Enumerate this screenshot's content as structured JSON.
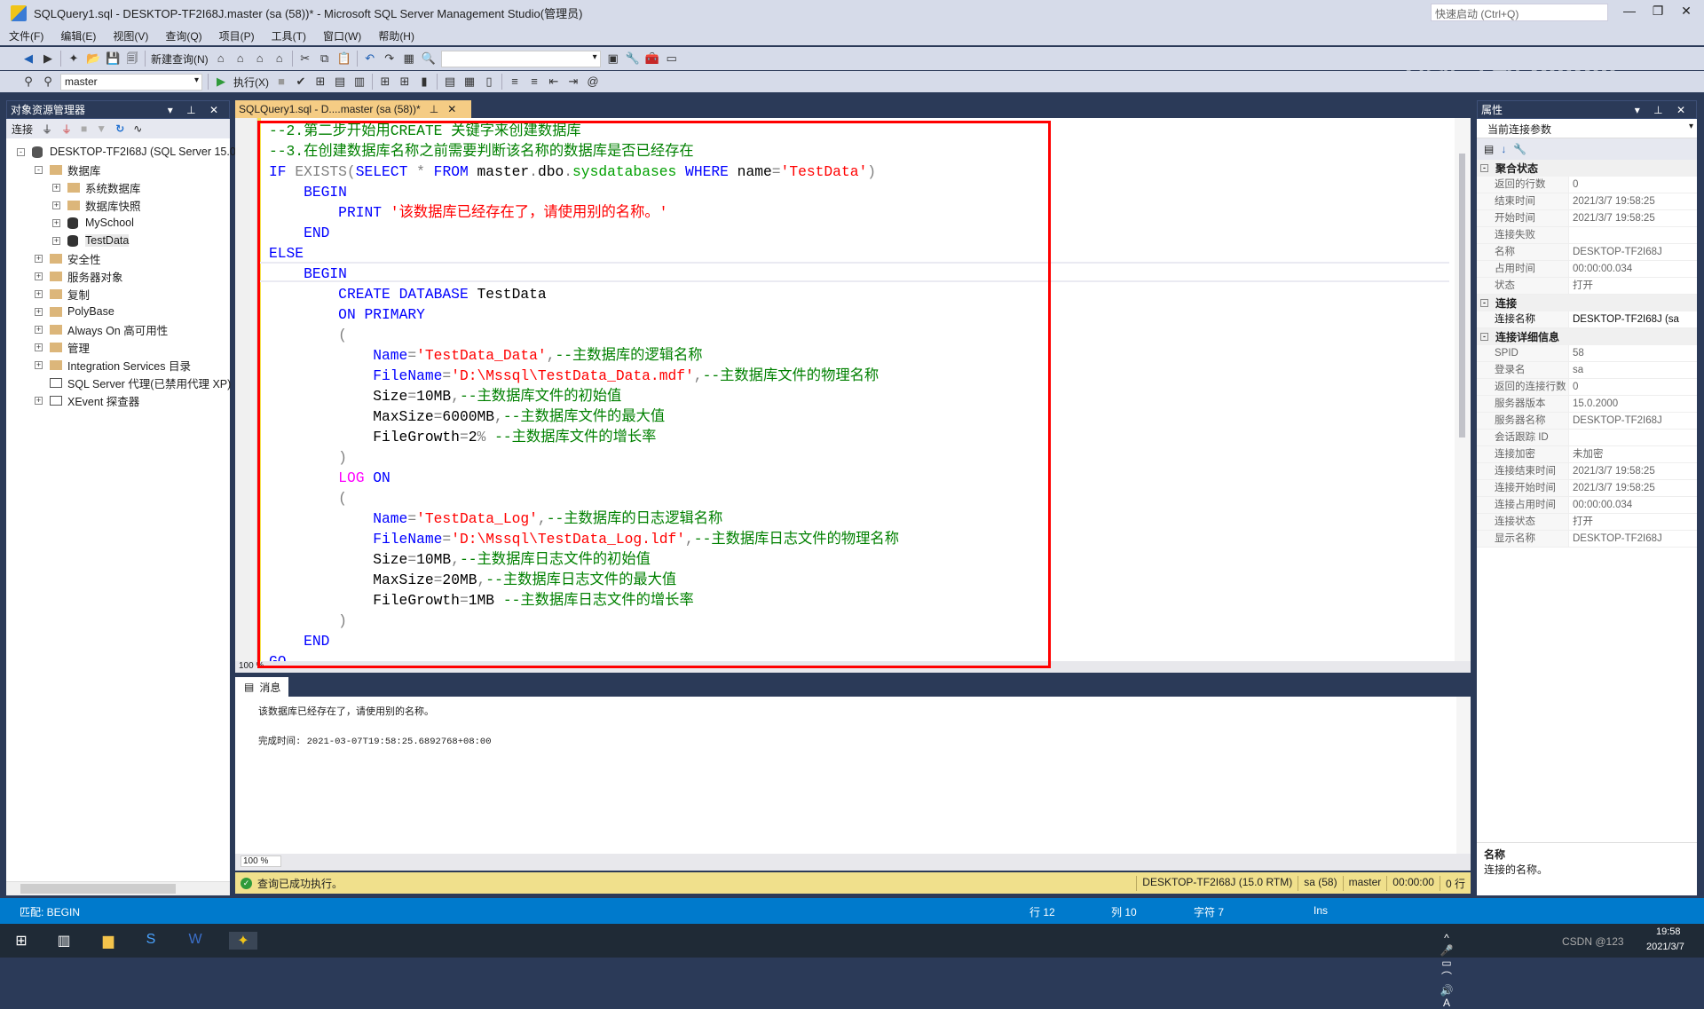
{
  "window": {
    "title": "SQLQuery1.sql - DESKTOP-TF2I68J.master (sa (58))* - Microsoft SQL Server Management Studio(管理员)",
    "quick_launch": "快速启动 (Ctrl+Q)"
  },
  "menu": [
    "文件(F)",
    "编辑(E)",
    "视图(V)",
    "查询(Q)",
    "项目(P)",
    "工具(T)",
    "窗口(W)",
    "帮助(H)"
  ],
  "toolbar": {
    "new_query": "新建查询(N)",
    "execute": "执行(X)",
    "database": "master"
  },
  "watermark": "九维互动 bilibili",
  "object_explorer": {
    "title": "对象资源管理器",
    "connect": "连接",
    "items": [
      {
        "label": "DESKTOP-TF2I68J (SQL Server 15.0",
        "level": 0,
        "state": "-",
        "icon": "server"
      },
      {
        "label": "数据库",
        "level": 1,
        "state": "-",
        "icon": "folder"
      },
      {
        "label": "系统数据库",
        "level": 2,
        "state": "+",
        "icon": "folder"
      },
      {
        "label": "数据库快照",
        "level": 2,
        "state": "+",
        "icon": "folder"
      },
      {
        "label": "MySchool",
        "level": 2,
        "state": "+",
        "icon": "database"
      },
      {
        "label": "TestData",
        "level": 2,
        "state": "+",
        "icon": "database"
      },
      {
        "label": "安全性",
        "level": 1,
        "state": "+",
        "icon": "folder"
      },
      {
        "label": "服务器对象",
        "level": 1,
        "state": "+",
        "icon": "folder"
      },
      {
        "label": "复制",
        "level": 1,
        "state": "+",
        "icon": "folder"
      },
      {
        "label": "PolyBase",
        "level": 1,
        "state": "+",
        "icon": "folder"
      },
      {
        "label": "Always On 高可用性",
        "level": 1,
        "state": "+",
        "icon": "folder"
      },
      {
        "label": "管理",
        "level": 1,
        "state": "+",
        "icon": "folder"
      },
      {
        "label": "Integration Services 目录",
        "level": 1,
        "state": "+",
        "icon": "folder"
      },
      {
        "label": "SQL Server 代理(已禁用代理 XP)",
        "level": 1,
        "state": "",
        "icon": "agent"
      },
      {
        "label": "XEvent 探查器",
        "level": 1,
        "state": "+",
        "icon": "xevent"
      }
    ]
  },
  "editor": {
    "tab": "SQLQuery1.sql - D....master (sa (58))*",
    "zoom": "100 %",
    "lines": [
      [
        [
          "c",
          "--2.第二步开始用CREATE 关键字来创建数据库"
        ]
      ],
      [
        [
          "c",
          "--3.在创建数据库名称之前需要判断该名称的数据库是否已经存在"
        ]
      ],
      [
        [
          "k",
          "IF "
        ],
        [
          "g",
          "EXISTS("
        ],
        [
          "k",
          "SELECT "
        ],
        [
          "g",
          "* "
        ],
        [
          "k",
          "FROM "
        ],
        [
          "p",
          "master"
        ],
        [
          "g",
          "."
        ],
        [
          "p",
          "dbo"
        ],
        [
          "g",
          "."
        ],
        [
          "f",
          "sysdatabases "
        ],
        [
          "k",
          "WHERE "
        ],
        [
          "p",
          "name"
        ],
        [
          "g",
          "="
        ],
        [
          "s",
          "'TestData'"
        ],
        [
          "g",
          ")"
        ]
      ],
      [
        [
          "p",
          "    "
        ],
        [
          "k",
          "BEGIN"
        ]
      ],
      [
        [
          "p",
          "        "
        ],
        [
          "k",
          "PRINT "
        ],
        [
          "s",
          "'该数据库已经存在了，请使用别的名称。'"
        ]
      ],
      [
        [
          "p",
          "    "
        ],
        [
          "k",
          "END"
        ]
      ],
      [
        [
          "k",
          "ELSE"
        ]
      ],
      [
        [
          "p",
          "    "
        ],
        [
          "k",
          "BEGIN"
        ]
      ],
      [
        [
          "p",
          "        "
        ],
        [
          "k",
          "CREATE DATABASE "
        ],
        [
          "p",
          "TestData"
        ]
      ],
      [
        [
          "p",
          "        "
        ],
        [
          "k",
          "ON PRIMARY"
        ]
      ],
      [
        [
          "p",
          "        "
        ],
        [
          "g",
          "("
        ]
      ],
      [
        [
          "p",
          "            "
        ],
        [
          "k",
          "Name"
        ],
        [
          "g",
          "="
        ],
        [
          "s",
          "'TestData_Data'"
        ],
        [
          "g",
          ","
        ],
        [
          "c",
          "--主数据库的逻辑名称"
        ]
      ],
      [
        [
          "p",
          "            "
        ],
        [
          "k",
          "FileName"
        ],
        [
          "g",
          "="
        ],
        [
          "s",
          "'D:\\Mssql\\TestData_Data.mdf'"
        ],
        [
          "g",
          ","
        ],
        [
          "c",
          "--主数据库文件的物理名称"
        ]
      ],
      [
        [
          "p",
          "            Size"
        ],
        [
          "g",
          "="
        ],
        [
          "p",
          "10MB"
        ],
        [
          "g",
          ","
        ],
        [
          "c",
          "--主数据库文件的初始值"
        ]
      ],
      [
        [
          "p",
          "            MaxSize"
        ],
        [
          "g",
          "="
        ],
        [
          "p",
          "6000MB"
        ],
        [
          "g",
          ","
        ],
        [
          "c",
          "--主数据库文件的最大值"
        ]
      ],
      [
        [
          "p",
          "            FileGrowth"
        ],
        [
          "g",
          "="
        ],
        [
          "p",
          "2"
        ],
        [
          "g",
          "% "
        ],
        [
          "c",
          "--主数据库文件的增长率"
        ]
      ],
      [
        [
          "p",
          "        "
        ],
        [
          "g",
          ")"
        ]
      ],
      [
        [
          "p",
          "        "
        ],
        [
          "m",
          "LOG "
        ],
        [
          "k",
          "ON"
        ]
      ],
      [
        [
          "p",
          "        "
        ],
        [
          "g",
          "("
        ]
      ],
      [
        [
          "p",
          "            "
        ],
        [
          "k",
          "Name"
        ],
        [
          "g",
          "="
        ],
        [
          "s",
          "'TestData_Log'"
        ],
        [
          "g",
          ","
        ],
        [
          "c",
          "--主数据库的日志逻辑名称"
        ]
      ],
      [
        [
          "p",
          "            "
        ],
        [
          "k",
          "FileName"
        ],
        [
          "g",
          "="
        ],
        [
          "s",
          "'D:\\Mssql\\TestData_Log.ldf'"
        ],
        [
          "g",
          ","
        ],
        [
          "c",
          "--主数据库日志文件的物理名称"
        ]
      ],
      [
        [
          "p",
          "            Size"
        ],
        [
          "g",
          "="
        ],
        [
          "p",
          "10MB"
        ],
        [
          "g",
          ","
        ],
        [
          "c",
          "--主数据库日志文件的初始值"
        ]
      ],
      [
        [
          "p",
          "            MaxSize"
        ],
        [
          "g",
          "="
        ],
        [
          "p",
          "20MB"
        ],
        [
          "g",
          ","
        ],
        [
          "c",
          "--主数据库日志文件的最大值"
        ]
      ],
      [
        [
          "p",
          "            FileGrowth"
        ],
        [
          "g",
          "="
        ],
        [
          "p",
          "1MB "
        ],
        [
          "c",
          "--主数据库日志文件的增长率"
        ]
      ],
      [
        [
          "p",
          "        "
        ],
        [
          "g",
          ")"
        ]
      ],
      [
        [
          "p",
          "    "
        ],
        [
          "k",
          "END"
        ]
      ],
      [
        [
          "k",
          "GO"
        ]
      ]
    ]
  },
  "results": {
    "tab": "消息",
    "message": "该数据库已经存在了，请使用别的名称。",
    "completion": "完成时间: 2021-03-07T19:58:25.6892768+08:00",
    "zoom": "100 %"
  },
  "query_status": {
    "text": "查询已成功执行。",
    "server": "DESKTOP-TF2I68J (15.0 RTM)",
    "user": "sa (58)",
    "database": "master",
    "elapsed": "00:00:00",
    "rows": "0 行"
  },
  "properties": {
    "title": "属性",
    "selector": "当前连接参数",
    "groups": [
      {
        "name": "聚合状态",
        "rows": [
          [
            "返回的行数",
            "0"
          ],
          [
            "结束时间",
            "2021/3/7 19:58:25"
          ],
          [
            "开始时间",
            "2021/3/7 19:58:25"
          ],
          [
            "连接失败",
            ""
          ],
          [
            "名称",
            "DESKTOP-TF2I68J"
          ],
          [
            "占用时间",
            "00:00:00.034"
          ],
          [
            "状态",
            "打开"
          ]
        ]
      },
      {
        "name": "连接",
        "rows": [
          [
            "连接名称",
            "DESKTOP-TF2I68J (sa"
          ]
        ]
      },
      {
        "name": "连接详细信息",
        "rows": [
          [
            "SPID",
            "58"
          ],
          [
            "登录名",
            "sa"
          ],
          [
            "返回的连接行数",
            "0"
          ],
          [
            "服务器版本",
            "15.0.2000"
          ],
          [
            "服务器名称",
            "DESKTOP-TF2I68J"
          ],
          [
            "会话跟踪 ID",
            ""
          ],
          [
            "连接加密",
            "未加密"
          ],
          [
            "连接结束时间",
            "2021/3/7 19:58:25"
          ],
          [
            "连接开始时间",
            "2021/3/7 19:58:25"
          ],
          [
            "连接占用时间",
            "00:00:00.034"
          ],
          [
            "连接状态",
            "打开"
          ],
          [
            "显示名称",
            "DESKTOP-TF2I68J"
          ]
        ]
      }
    ],
    "desc_title": "名称",
    "desc_text": "连接的名称。"
  },
  "statusbar": {
    "match": "匹配: BEGIN",
    "line": "行 12",
    "col": "列 10",
    "char": "字符 7",
    "mode": "Ins"
  },
  "taskbar": {
    "time": "19:58",
    "date": "2021/3/7",
    "tray_text": "CSDN @123"
  },
  "colors": {
    "accent": "#007acc",
    "comment": "#008000",
    "keyword": "#0000ff",
    "string": "#ff0000",
    "highlight_box": "#ff0000",
    "status_yellow": "#f0e08c"
  }
}
